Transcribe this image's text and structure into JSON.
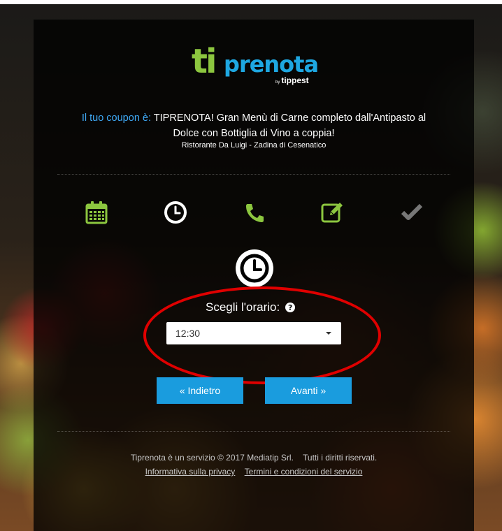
{
  "brand": {
    "logo_ti": "ti",
    "logo_prenota": "prenota",
    "logo_by": "by",
    "logo_tippest": "tippest",
    "colors": {
      "green": "#8cc63f",
      "blue": "#1ea7e1",
      "accent_button": "#1a9cde",
      "highlight": "#e00000"
    }
  },
  "coupon": {
    "label": "Il tuo coupon è:",
    "text": "TIPRENOTA! Gran Menù di Carne completo dall'Antipasto al Dolce con Bottiglia di Vino a coppia!",
    "restaurant": "Ristorante Da Luigi - Zadina di Cesenatico"
  },
  "steps": [
    {
      "icon": "calendar-icon",
      "color": "#8cc63f",
      "state": "done"
    },
    {
      "icon": "clock-icon",
      "color": "#ffffff",
      "state": "active"
    },
    {
      "icon": "phone-icon",
      "color": "#8cc63f",
      "state": "done"
    },
    {
      "icon": "edit-icon",
      "color": "#8cc63f",
      "state": "done"
    },
    {
      "icon": "check-icon",
      "color": "#777777",
      "state": "pending"
    }
  ],
  "form": {
    "label": "Scegli l'orario:",
    "help_icon": "?",
    "time_value": "12:30"
  },
  "buttons": {
    "back": "« Indietro",
    "next": "Avanti »"
  },
  "footer": {
    "copyright": "Tiprenota è un servizio © 2017 Mediatip Srl.",
    "rights": "Tutti i diritti riservati.",
    "privacy_link": "Informativa sulla privacy",
    "terms_link": "Termini e condizioni del servizio"
  }
}
